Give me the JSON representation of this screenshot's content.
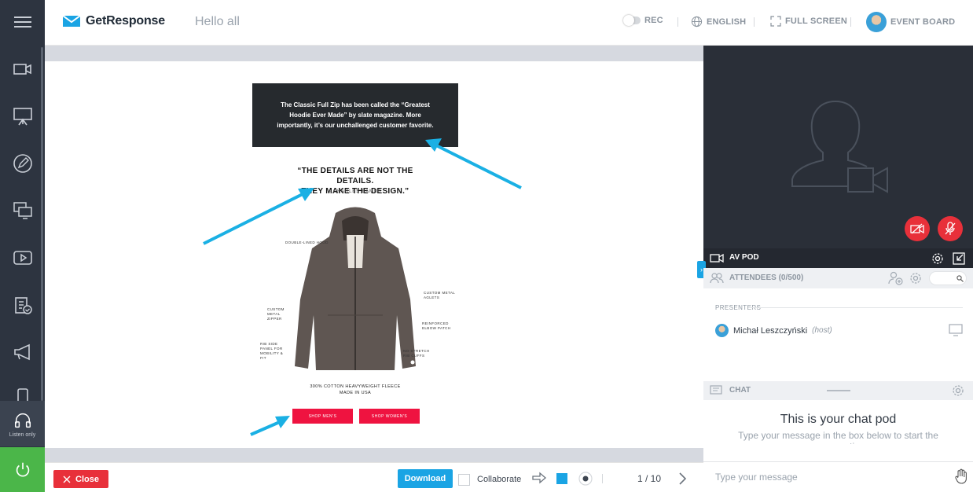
{
  "header": {
    "brand": "GetResponse",
    "session_title": "Hello all",
    "rec_label": "REC",
    "language_label": "ENGLISH",
    "fullscreen_label": "FULL SCREEN",
    "event_board_label": "EVENT BOARD"
  },
  "sidebar": {
    "items": [
      {
        "icon": "menu-icon"
      },
      {
        "icon": "video-camera-icon"
      },
      {
        "icon": "presentation-board-icon"
      },
      {
        "icon": "pencil-icon"
      },
      {
        "icon": "desktop-share-icon"
      },
      {
        "icon": "play-video-icon"
      },
      {
        "icon": "test-clipboard-icon"
      },
      {
        "icon": "megaphone-icon"
      },
      {
        "icon": "phone-icon"
      }
    ],
    "listen_label": "Listen only",
    "power_color": "#4bb649"
  },
  "slide": {
    "banner_text": "The Classic Full Zip has been called the “Greatest Hoodie Ever Made” by slate magazine. More importantly, it’s our unchallenged customer favorite.",
    "quote_line1": "“THE DETAILS ARE NOT THE DETAILS.",
    "quote_line2": "THEY MAKE THE DESIGN.”",
    "quote_author": "- CHARLES EAMES",
    "callouts": {
      "hood": "DOUBLE-LINED HOOD",
      "zipper": "CUSTOM METAL ZIPPER",
      "side_panel": "RIB SIDE PANEL FOR MOBILITY & FIT",
      "aglets": "CUSTOM METAL AGLETS",
      "elbow": "REINFORCED ELBOW PATCH",
      "cuffs": "NO-STRETCH RIB CUFFS"
    },
    "fleece_line1": "300% COTTON HEAVYWEIGHT FLEECE",
    "fleece_line2": "MADE IN USA",
    "shop_mens": "SHOP MEN'S",
    "shop_womens": "SHOP WOMEN'S",
    "arrow_color": "#1ab0e4"
  },
  "toolbar": {
    "close_label": "Close",
    "download_label": "Download",
    "collaborate_label": "Collaborate",
    "page_indicator": "1 / 10"
  },
  "av_pod": {
    "title": "AV POD"
  },
  "attendees": {
    "title": "ATTENDEES (0/500)",
    "section_label": "PRESENTERS",
    "presenter_name": "Michał Leszczyński",
    "presenter_role": "(host)"
  },
  "chat": {
    "title": "CHAT",
    "empty_title": "This is your chat pod",
    "empty_subtitle": "Type your message in the box below to start the conversation",
    "input_placeholder": "Type your message"
  }
}
